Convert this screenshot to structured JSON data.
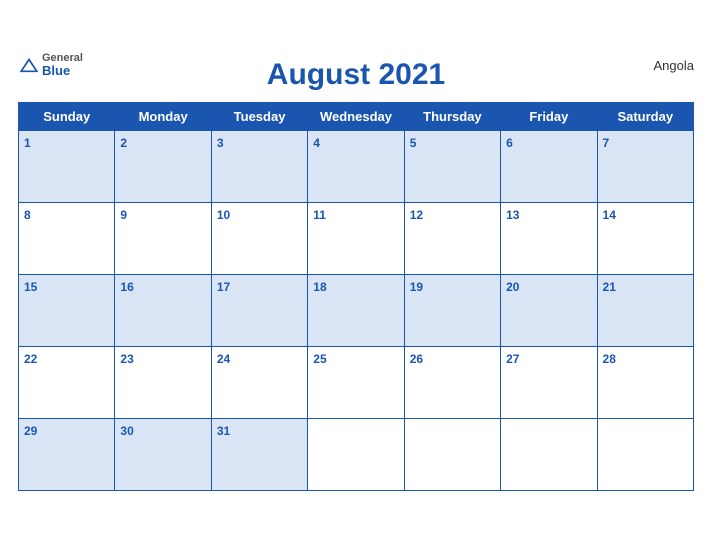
{
  "header": {
    "logo_general": "General",
    "logo_blue": "Blue",
    "month_title": "August 2021",
    "country": "Angola"
  },
  "weekdays": [
    "Sunday",
    "Monday",
    "Tuesday",
    "Wednesday",
    "Thursday",
    "Friday",
    "Saturday"
  ],
  "weeks": [
    [
      {
        "day": "1",
        "empty": false
      },
      {
        "day": "2",
        "empty": false
      },
      {
        "day": "3",
        "empty": false
      },
      {
        "day": "4",
        "empty": false
      },
      {
        "day": "5",
        "empty": false
      },
      {
        "day": "6",
        "empty": false
      },
      {
        "day": "7",
        "empty": false
      }
    ],
    [
      {
        "day": "8",
        "empty": false
      },
      {
        "day": "9",
        "empty": false
      },
      {
        "day": "10",
        "empty": false
      },
      {
        "day": "11",
        "empty": false
      },
      {
        "day": "12",
        "empty": false
      },
      {
        "day": "13",
        "empty": false
      },
      {
        "day": "14",
        "empty": false
      }
    ],
    [
      {
        "day": "15",
        "empty": false
      },
      {
        "day": "16",
        "empty": false
      },
      {
        "day": "17",
        "empty": false
      },
      {
        "day": "18",
        "empty": false
      },
      {
        "day": "19",
        "empty": false
      },
      {
        "day": "20",
        "empty": false
      },
      {
        "day": "21",
        "empty": false
      }
    ],
    [
      {
        "day": "22",
        "empty": false
      },
      {
        "day": "23",
        "empty": false
      },
      {
        "day": "24",
        "empty": false
      },
      {
        "day": "25",
        "empty": false
      },
      {
        "day": "26",
        "empty": false
      },
      {
        "day": "27",
        "empty": false
      },
      {
        "day": "28",
        "empty": false
      }
    ],
    [
      {
        "day": "29",
        "empty": false
      },
      {
        "day": "30",
        "empty": false
      },
      {
        "day": "31",
        "empty": false
      },
      {
        "day": "",
        "empty": true
      },
      {
        "day": "",
        "empty": true
      },
      {
        "day": "",
        "empty": true
      },
      {
        "day": "",
        "empty": true
      }
    ]
  ]
}
